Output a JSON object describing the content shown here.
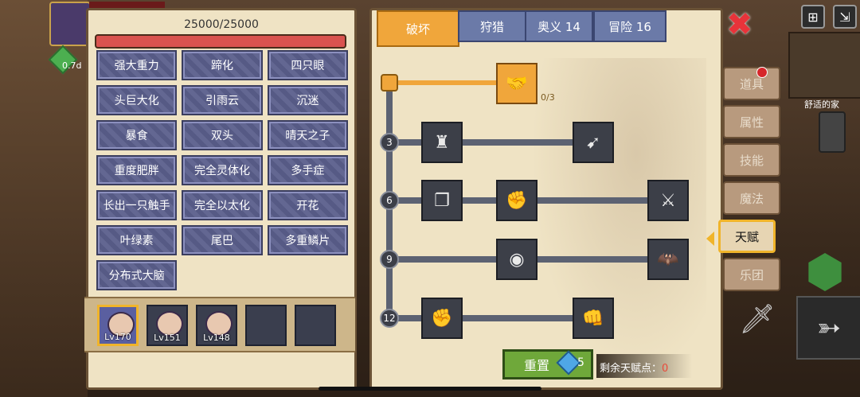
{
  "hp": {
    "text": "25000/25000",
    "current": 25000,
    "max": 25000
  },
  "hud": {
    "time_left": "0.7d"
  },
  "traits": [
    "强大重力",
    "蹄化",
    "四只眼",
    "头巨大化",
    "引雨云",
    "沉迷",
    "暴食",
    "双头",
    "晴天之子",
    "重度肥胖",
    "完全灵体化",
    "多手症",
    "长出一只触手",
    "完全以太化",
    "开花",
    "叶绿素",
    "尾巴",
    "多重鳞片",
    "分布式大脑"
  ],
  "team": [
    {
      "level": "Lv170",
      "selected": true
    },
    {
      "level": "Lv151",
      "selected": false
    },
    {
      "level": "Lv148",
      "selected": false
    },
    {
      "level": "",
      "selected": false
    },
    {
      "level": "",
      "selected": false
    }
  ],
  "tabs": [
    {
      "label": "破坏",
      "active": true
    },
    {
      "label": "狩猎",
      "active": false
    },
    {
      "label": "奥义 14",
      "active": false
    },
    {
      "label": "冒险 16",
      "active": false
    }
  ],
  "talent_tree": {
    "top_node_progress": "0/3",
    "level_markers": [
      "3",
      "6",
      "9",
      "12"
    ]
  },
  "reset": {
    "label": "重置",
    "cost": "5"
  },
  "remaining_points": {
    "label": "剩余天赋点：",
    "value": "0"
  },
  "side_menu": [
    "道具",
    "属性",
    "技能",
    "魔法",
    "天赋",
    "乐团"
  ],
  "side_menu_active": "天赋",
  "map": {
    "label": "舒适的家"
  }
}
